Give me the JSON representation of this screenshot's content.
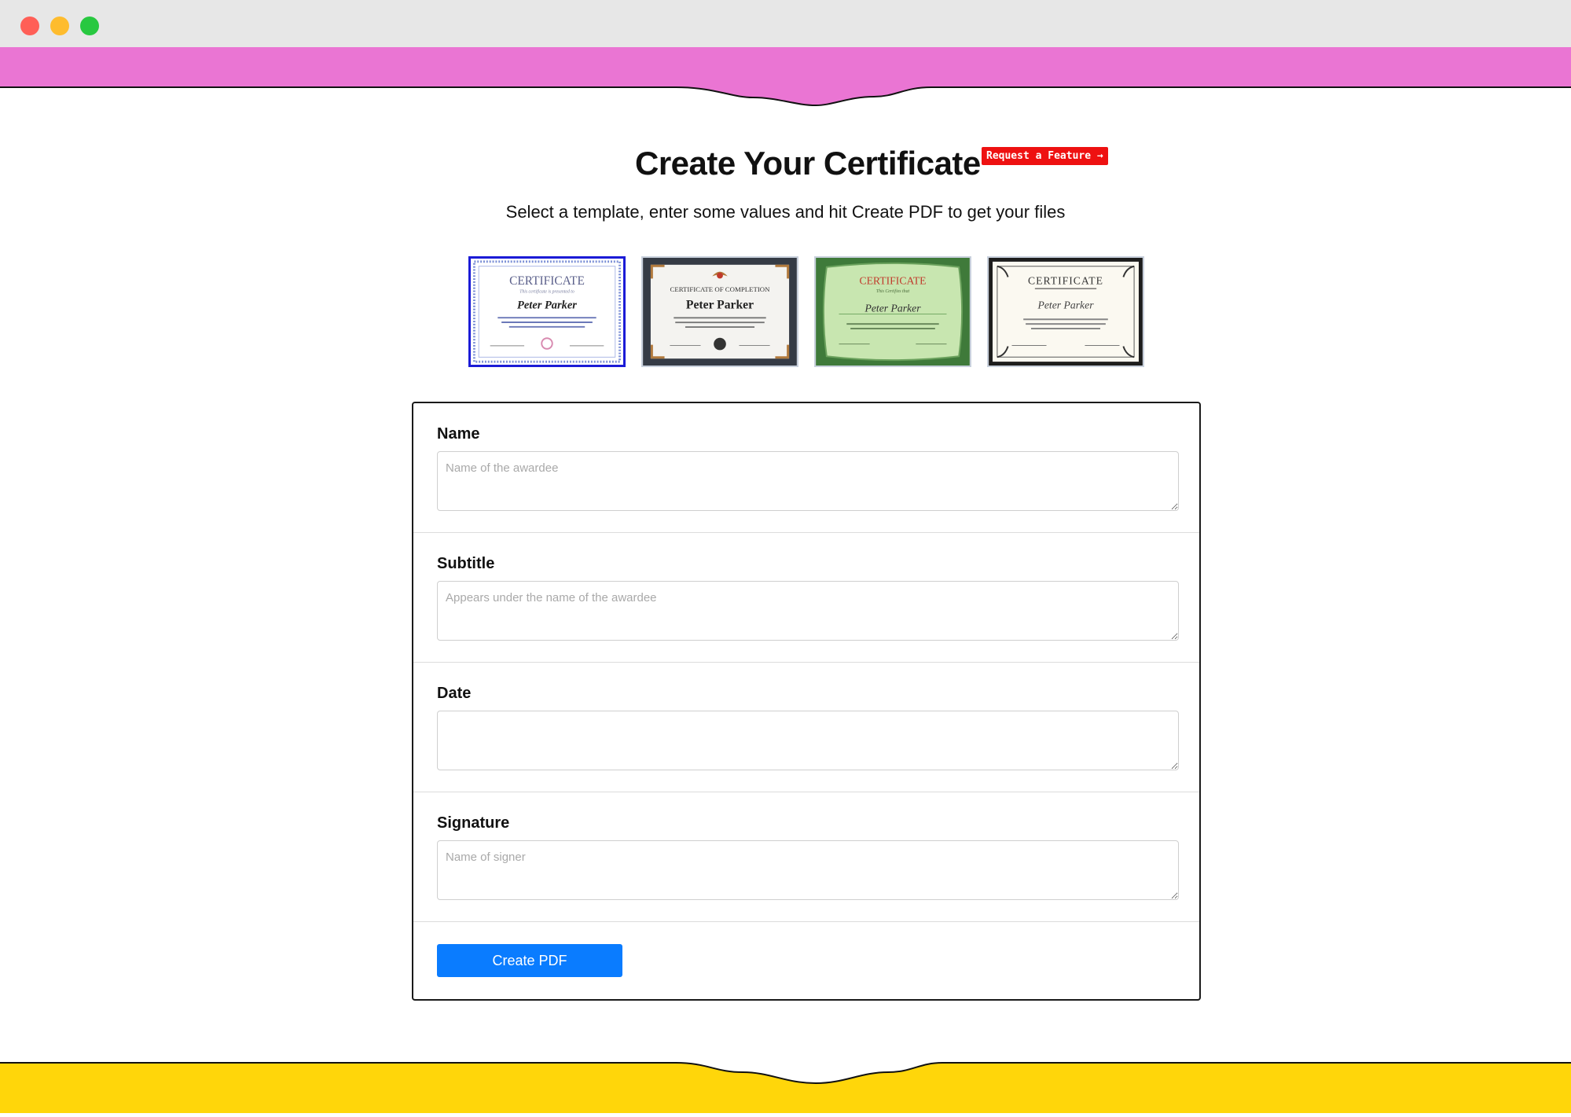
{
  "header": {
    "title": "Create Your Certificate",
    "feature_badge": "Request a Feature →",
    "subtitle": "Select a template, enter some values and hit Create PDF to get your files"
  },
  "colors": {
    "top_band": "#ea75d3",
    "bottom_band": "#ffd60a",
    "primary_button": "#0a7cff",
    "badge": "#ee1111",
    "selected_template_border": "#1b1bd6"
  },
  "templates": {
    "selected_index": 0,
    "items": [
      {
        "heading": "CERTIFICATE",
        "line": "This certificate is presented to",
        "name": "Peter Parker"
      },
      {
        "heading": "CERTIFICATE OF COMPLETION",
        "name": "Peter Parker"
      },
      {
        "heading": "CERTIFICATE",
        "line": "This Certifies that",
        "name": "Peter Parker"
      },
      {
        "heading": "CERTIFICATE",
        "name": "Peter Parker"
      }
    ]
  },
  "form": {
    "fields": [
      {
        "label": "Name",
        "placeholder": "Name of the awardee",
        "value": ""
      },
      {
        "label": "Subtitle",
        "placeholder": "Appears under the name of the awardee",
        "value": ""
      },
      {
        "label": "Date",
        "placeholder": "",
        "value": ""
      },
      {
        "label": "Signature",
        "placeholder": "Name of signer",
        "value": ""
      }
    ],
    "submit_label": "Create PDF"
  }
}
